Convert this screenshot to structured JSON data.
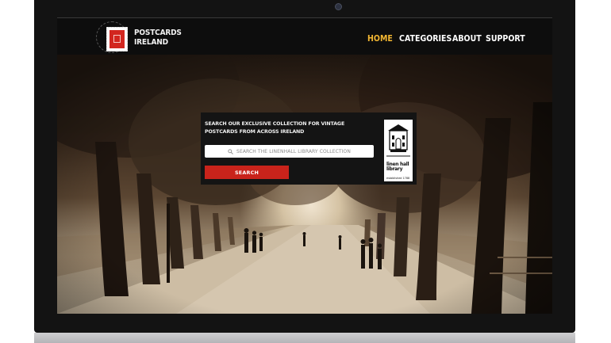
{
  "site": {
    "logo_line1": "POSTCARDS",
    "logo_line2": "IRELAND"
  },
  "nav": {
    "items": [
      {
        "label": "HOME",
        "active": true
      },
      {
        "label": "CATEGORIES",
        "active": false
      },
      {
        "label": "ABOUT",
        "active": false
      },
      {
        "label": "SUPPORT",
        "active": false
      }
    ]
  },
  "search": {
    "heading": "SEARCH OUR EXCLUSIVE COLLECTION FOR VINTAGE POSTCARDS FROM ACROSS IRELAND",
    "placeholder": "SEARCH THE LINENHALL LIBRARY COLLECTION",
    "button_label": "SEARCH"
  },
  "partner": {
    "name_line1": "linen hall",
    "name_line2": "library",
    "established": "established 1788"
  },
  "colors": {
    "accent_active_nav": "#f2b632",
    "search_button": "#c9231b",
    "stamp_red": "#d2261f"
  }
}
